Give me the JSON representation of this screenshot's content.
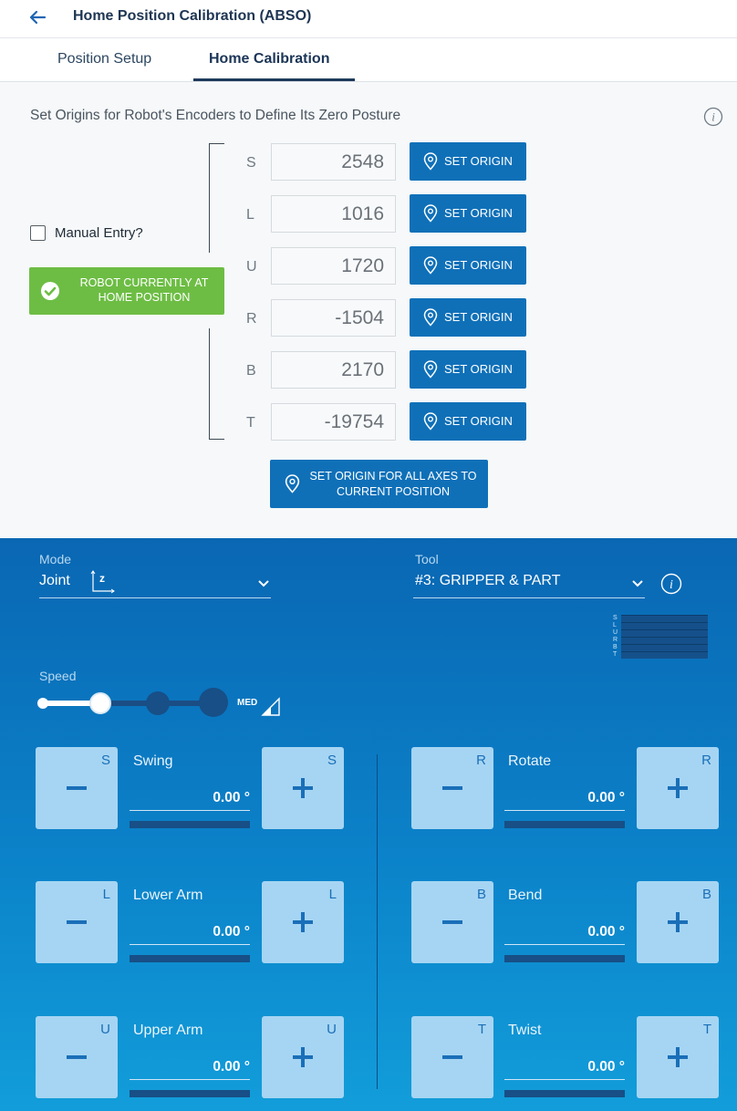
{
  "header": {
    "title": "Home Position Calibration (ABSO)"
  },
  "tabs": [
    {
      "label": "Position Setup"
    },
    {
      "label": "Home Calibration",
      "selected": true
    }
  ],
  "calibration": {
    "heading": "Set Origins for Robot's Encoders to Define Its Zero Posture",
    "manual_entry": {
      "label": "Manual Entry?",
      "checked": false
    },
    "home_status": "ROBOT CURRENTLY AT HOME POSITION",
    "axes": [
      {
        "axis": "S",
        "value": "2548",
        "button": "SET ORIGIN"
      },
      {
        "axis": "L",
        "value": "1016",
        "button": "SET ORIGIN"
      },
      {
        "axis": "U",
        "value": "1720",
        "button": "SET ORIGIN"
      },
      {
        "axis": "R",
        "value": "-1504",
        "button": "SET ORIGIN"
      },
      {
        "axis": "B",
        "value": "2170",
        "button": "SET ORIGIN"
      },
      {
        "axis": "T",
        "value": "-19754",
        "button": "SET ORIGIN"
      }
    ],
    "set_all_label": "SET ORIGIN FOR ALL AXES TO CURRENT POSITION"
  },
  "jog": {
    "mode": {
      "caption": "Mode",
      "value": "Joint"
    },
    "tool": {
      "caption": "Tool",
      "value": "#3: GRIPPER & PART"
    },
    "mini_axes": [
      "S",
      "L",
      "U",
      "R",
      "B",
      "T"
    ],
    "speed": {
      "caption": "Speed",
      "level_label": "MED",
      "level_index": 1,
      "levels": 4
    },
    "joints": [
      {
        "axis": "S",
        "name": "Swing",
        "value": "0.00 °"
      },
      {
        "axis": "L",
        "name": "Lower Arm",
        "value": "0.00 °"
      },
      {
        "axis": "U",
        "name": "Upper Arm",
        "value": "0.00 °"
      },
      {
        "axis": "R",
        "name": "Rotate",
        "value": "0.00 °"
      },
      {
        "axis": "B",
        "name": "Bend",
        "value": "0.00 °"
      },
      {
        "axis": "T",
        "name": "Twist",
        "value": "0.00 °"
      }
    ]
  },
  "colors": {
    "accent_blue": "#0f70b8",
    "home_green": "#6dbd44",
    "jog_panel": "#0b82c9",
    "jog_button": "#a6d5f3"
  },
  "icons": {
    "back": "arrow-left-icon",
    "info": "info-icon",
    "pin": "location-pin-icon",
    "check": "check-circle-icon",
    "chevron": "chevron-down-icon",
    "coordinate": "joint-coordinate-icon"
  }
}
